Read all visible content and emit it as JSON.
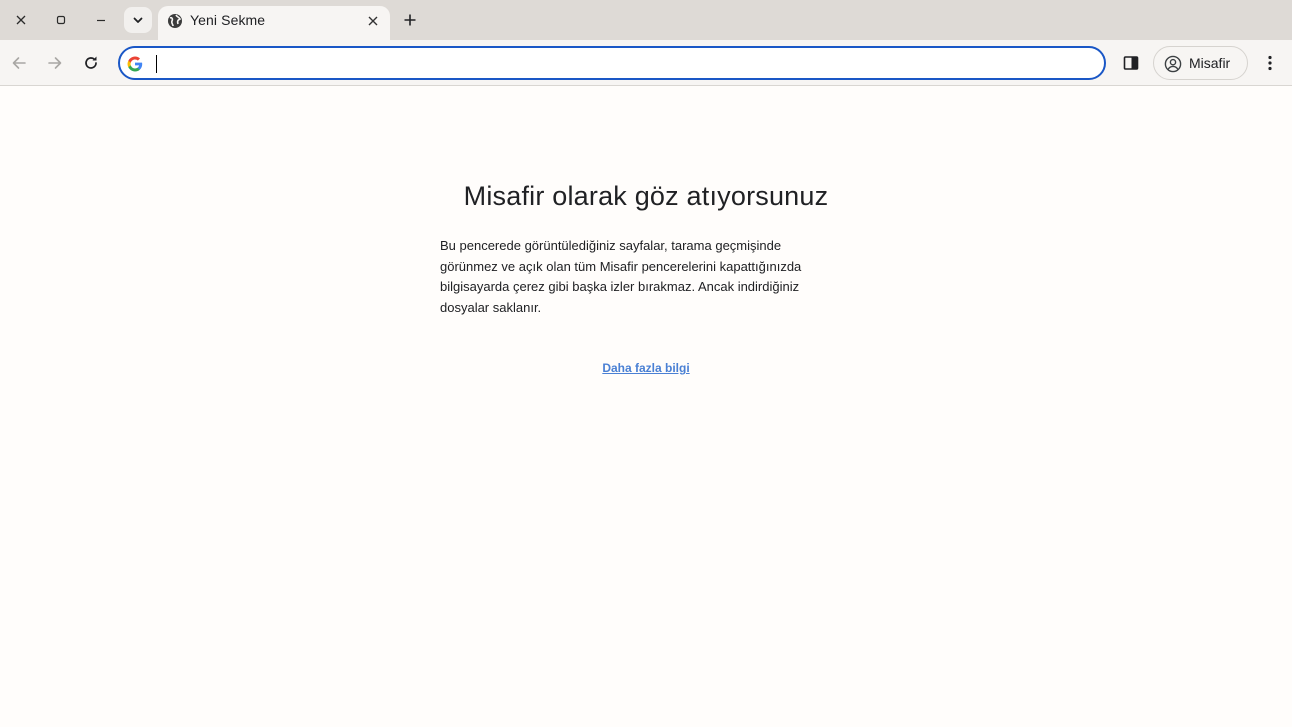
{
  "window_controls": {
    "close_icon": "close-icon",
    "maximize_icon": "maximize-icon",
    "minimize_icon": "minimize-icon"
  },
  "tab": {
    "title": "Yeni Sekme",
    "favicon": "globe-icon"
  },
  "toolbar": {
    "omnibox_value": "",
    "profile_label": "Misafir"
  },
  "colors": {
    "omnibox_focus": "#1a57c6",
    "link": "#4a80d4",
    "tabstrip_bg": "#dedad6",
    "toolbar_bg": "#f7f5f3"
  },
  "content": {
    "title": "Misafir olarak göz atıyorsunuz",
    "description": "Bu pencerede görüntülediğiniz sayfalar, tarama geçmişinde görünmez ve açık olan tüm Misafir pencerelerini kapattığınızda bilgisayarda çerez gibi başka izler bırakmaz. Ancak indirdiğiniz dosyalar saklanır.",
    "learn_more": "Daha fazla bilgi"
  }
}
